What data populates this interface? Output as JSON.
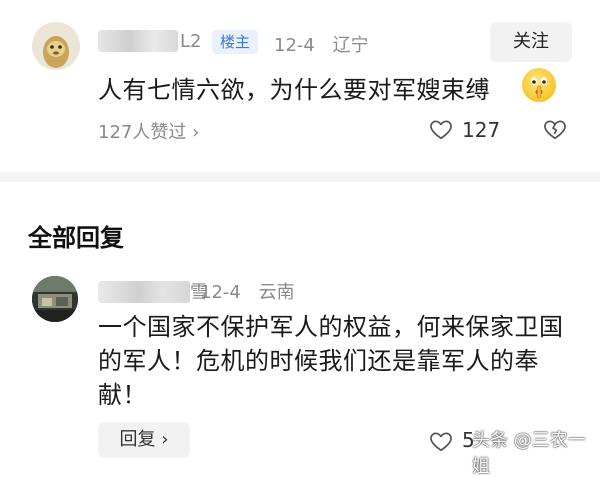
{
  "main_comment": {
    "username_visible": "L2",
    "op_badge": "楼主",
    "date": "12-4",
    "location": "辽宁",
    "follow_label": "关注",
    "text": "人有七情六欲，为什么要对军嫂束缚",
    "emoji": "shushing-face",
    "likes_link": "127人赞过 ›",
    "like_count": "127"
  },
  "replies": {
    "section_title": "全部回复",
    "items": [
      {
        "username_visible": "雪",
        "date": "12-4",
        "location": "云南",
        "text": "一个国家不保护军人的权益，何来保家卫国的军人！危机的时候我们还是靠军人的奉献！",
        "reply_label": "回复 ›",
        "like_count": "5"
      }
    ]
  },
  "watermark": "头条 @三农一姐",
  "colors": {
    "muted_text": "#8a8a8a",
    "badge_blue": "#3b7ad9",
    "button_bg": "#f2f2f2"
  }
}
